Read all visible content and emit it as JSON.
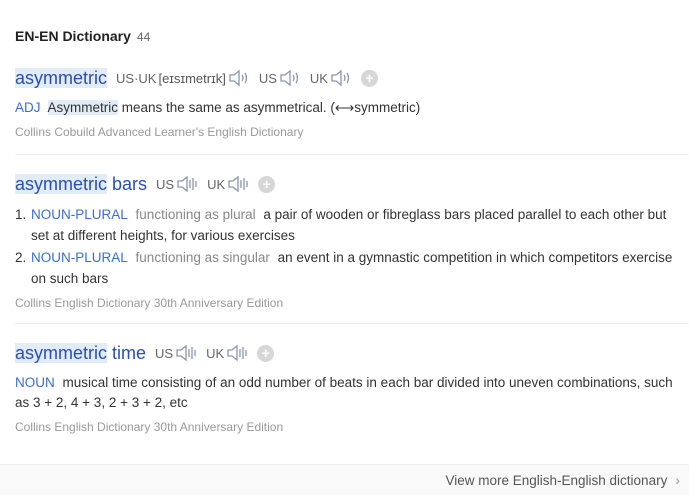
{
  "header": {
    "title": "EN-EN Dictionary",
    "count": "44"
  },
  "entries": [
    {
      "word_hl": "asymmetric",
      "word_rest": "",
      "pron": [
        {
          "label": "US·UK",
          "phonetic": "[eɪsɪmetrɪk]"
        },
        {
          "label": "US",
          "phonetic": ""
        },
        {
          "label": "UK",
          "phonetic": ""
        }
      ],
      "pos": "ADJ",
      "hl_word": "Asymmetric",
      "definition": " means the same as asymmetrical. (⟷symmetric)",
      "source": "Collins Cobuild Advanced Learner's English Dictionary"
    },
    {
      "word_hl": "asymmetric",
      "word_rest": " bars",
      "pron": [
        {
          "label": "US"
        },
        {
          "label": "UK"
        }
      ],
      "senses": [
        {
          "num": "1.",
          "pos": "NOUN-PLURAL",
          "gram": "functioning as plural",
          "text": "a pair of wooden or fibreglass bars placed parallel to each other but set at different heights, for various exercises"
        },
        {
          "num": "2.",
          "pos": "NOUN-PLURAL",
          "gram": "functioning as singular",
          "text": "an event in a gymnastic competition in which competitors exercise on such bars"
        }
      ],
      "source": "Collins English Dictionary 30th Anniversary Edition"
    },
    {
      "word_hl": "asymmetric",
      "word_rest": " time",
      "pron": [
        {
          "label": "US"
        },
        {
          "label": "UK"
        }
      ],
      "pos": "NOUN",
      "definition": "musical time consisting of an odd number of beats in each bar divided into uneven combinations, such as 3 + 2, 4 + 3, 2 + 3 + 2, etc",
      "source": "Collins English Dictionary 30th Anniversary Edition"
    }
  ],
  "footer": {
    "more_label": "View more English-English dictionary"
  },
  "icons": {
    "speaker": "speaker-icon",
    "add": "plus-icon",
    "chevron": "chevron-right-icon"
  },
  "colors": {
    "headword": "#2a4fb0",
    "pos": "#3a6fd0",
    "highlight": "#e2ecf7"
  }
}
